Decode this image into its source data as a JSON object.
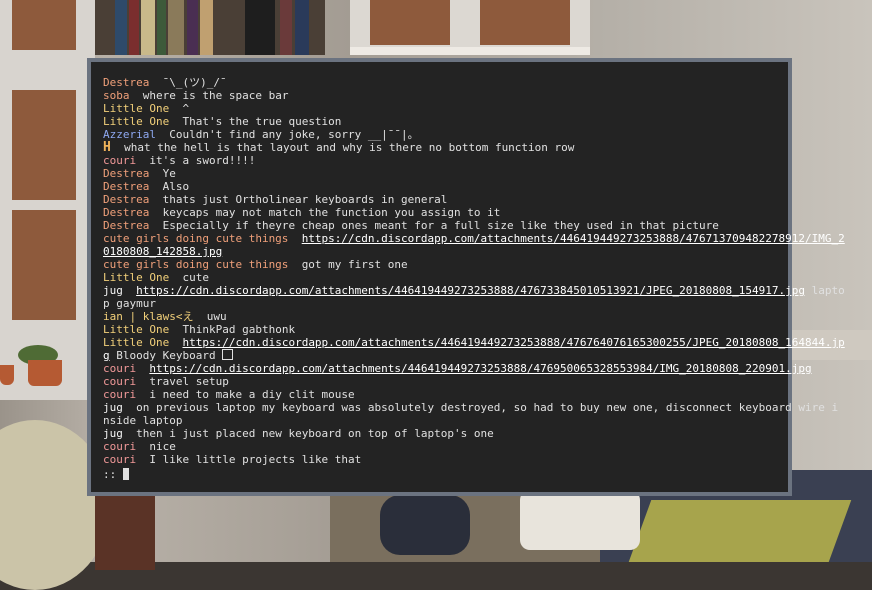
{
  "terminal": {
    "lines": [
      {
        "nick": "Destrea",
        "color": "#f0a07a",
        "text": "¯\\_(ツ)_/¯"
      },
      {
        "nick": "soba",
        "color": "#f0a07a",
        "text": "where is the space bar"
      },
      {
        "nick": "Little One",
        "color": "#f2d07a",
        "text": "^"
      },
      {
        "nick": "Little One",
        "color": "#f2d07a",
        "text": "That's the true question"
      },
      {
        "nick": "Azzerial",
        "color": "#8ea8f0",
        "text": "Couldn't find any joke, sorry __|¯¯|。"
      },
      {
        "nick": "H",
        "color": "#f0b35a",
        "text": "what the hell is that layout and why is there no bottom function row"
      },
      {
        "nick": "couri",
        "color": "#f09898",
        "text": "it's a sword!!!!"
      },
      {
        "nick": "Destrea",
        "color": "#f0a07a",
        "text": "Ye"
      },
      {
        "nick": "Destrea",
        "color": "#f0a07a",
        "text": "Also"
      },
      {
        "nick": "Destrea",
        "color": "#f0a07a",
        "text": "thats just Ortholinear keyboards in general"
      },
      {
        "nick": "Destrea",
        "color": "#f0a07a",
        "text": "keycaps may not match the function you assign to it"
      },
      {
        "nick": "Destrea",
        "color": "#f0a07a",
        "text": "Especially if theyre cheap ones meant for a full size like they used in that picture"
      },
      {
        "nick": "cute girls doing cute things",
        "color": "#f0a07a",
        "url1": "https://cdn.discordapp.com/attachments/446419449273253888/476713709482278912/IMG_2",
        "url2": "0180808_142858.jpg"
      },
      {
        "nick": "cute girls doing cute things",
        "color": "#f0a07a",
        "text": "got my first one"
      },
      {
        "nick": "Little One",
        "color": "#f2d07a",
        "text": "cute"
      },
      {
        "nick": "jug",
        "color": "#f4f4f4",
        "url": "https://cdn.discordapp.com/attachments/446419449273253888/476733845010513921/JPEG_20180808_154917.jpg",
        "after": "lapto",
        "cont": "p gaymur"
      },
      {
        "nick": "ian | klaws<え",
        "color": "#f2d07a",
        "text": "uwu"
      },
      {
        "nick": "Little One",
        "color": "#f2d07a",
        "text": "ThinkPad gabthonk"
      },
      {
        "nick": "Little One",
        "color": "#f2d07a",
        "url": "https://cdn.discordapp.com/attachments/446419449273253888/476764076165300255/JPEG_20180808_164844.jp",
        "cont": "g Bloody Keyboard"
      },
      {
        "nick": "couri",
        "color": "#f09898",
        "url": "https://cdn.discordapp.com/attachments/446419449273253888/476950065328553984/IMG_20180808_220901.jpg"
      },
      {
        "nick": "couri",
        "color": "#f09898",
        "text": "travel setup"
      },
      {
        "nick": "couri",
        "color": "#f09898",
        "text": "i need to make a diy clit mouse"
      },
      {
        "nick": "jug",
        "color": "#f4f4f4",
        "text": "on previous laptop my keyboard was absolutely destroyed, so had to buy new one, disconnect keyboard wire i",
        "cont": "nside laptop"
      },
      {
        "nick": "jug",
        "color": "#f4f4f4",
        "text": "then i just placed new keyboard on top of laptop's one"
      },
      {
        "nick": "couri",
        "color": "#f09898",
        "text": "nice"
      },
      {
        "nick": "couri",
        "color": "#f09898",
        "text": "I like little projects like that"
      }
    ],
    "prompt": "::"
  }
}
